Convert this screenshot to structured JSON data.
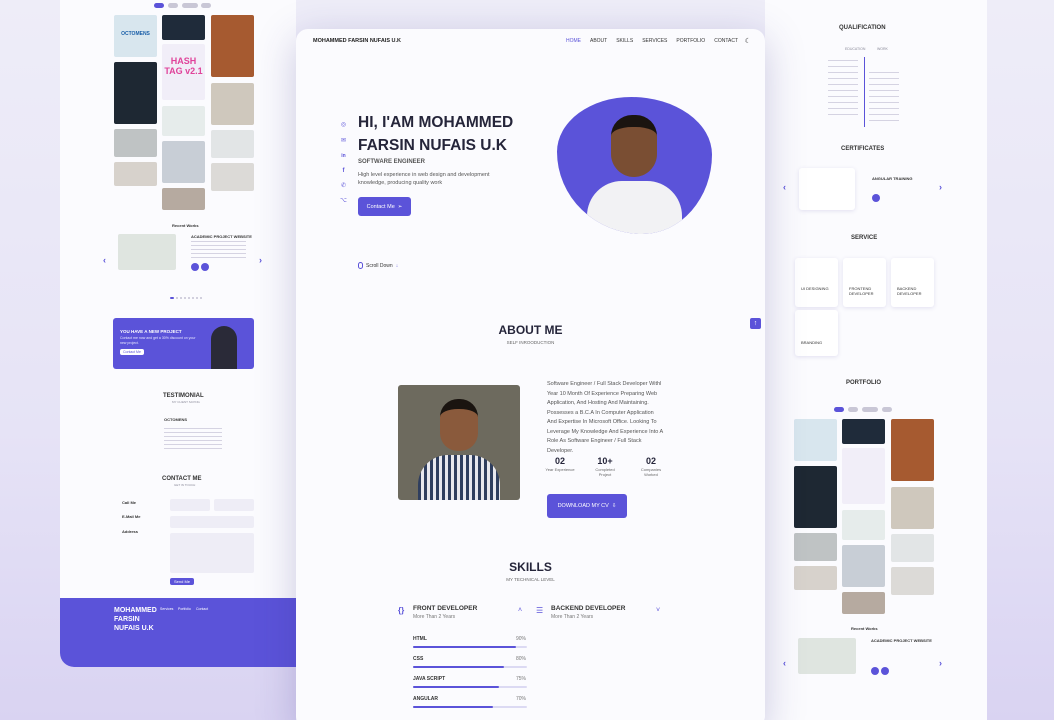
{
  "colors": {
    "accent": "#5b53d9",
    "bg": "#eeedf8"
  },
  "nav": {
    "logo": "MOHAMMED FARSIN NUFAIS U.K",
    "links": [
      "HOME",
      "ABOUT",
      "SKILLS",
      "SERVICES",
      "PORTFOLIO",
      "CONTACT"
    ],
    "theme_icon": "moon-icon"
  },
  "hero": {
    "title": "HI, I'AM MOHAMMED FARSIN NUFAIS U.K",
    "subtitle": "SOFTWARE ENGINEER",
    "description": "High level experience in web design and development knowledge, producing quality work",
    "cta": "Contact Me",
    "scroll": "Scroll Down",
    "socials": [
      "instagram-icon",
      "mail-icon",
      "linkedin-icon",
      "facebook-icon",
      "whatsapp-icon",
      "github-icon"
    ]
  },
  "about": {
    "title": "ABOUT ME",
    "subtitle": "SELF INROODUCTION",
    "text": "Software Engineer / Full Stack Developer Withl Year 10 Month Of Experience Preparing Web Application, And Hosting And Maintaining. Possesses a B.C.A In Computer Application And Expertise In Microsoft Office. Looking To Leverage My Knowledge And Experience Into A Role As Software Engineer / Full Stack Developer.",
    "stats": [
      {
        "num": "02",
        "label": "Year Experience"
      },
      {
        "num": "10+",
        "label": "Completed Project"
      },
      {
        "num": "02",
        "label": "Companies Worked"
      }
    ],
    "download": "DOWNLOAD MY CV"
  },
  "skills": {
    "title": "SKILLS",
    "subtitle": "MY TECHNICAL LEVEL",
    "frontend": {
      "title": "FRONT DEVELOPER",
      "sub": "More Than 2 Years"
    },
    "backend": {
      "title": "BACKEND DEVELOPER",
      "sub": "More Than 2 Years"
    },
    "items": [
      {
        "name": "HTML",
        "pct": "90%",
        "value": 0.9
      },
      {
        "name": "CSS",
        "pct": "80%",
        "value": 0.8
      },
      {
        "name": "JAVA SCRIPT",
        "pct": "75%",
        "value": 0.75
      },
      {
        "name": "ANGULAR",
        "pct": "70%",
        "value": 0.7
      }
    ]
  },
  "left": {
    "recent": "Recent Works",
    "project_title": "ACADEMIC PROJECT WEBSITE",
    "banner_title": "YOU HAVE A NEW PROJECT",
    "banner_text": "Contact me now and get a 30% discount on your new project.",
    "banner_btn": "Contact Me",
    "testimonial": "TESTIMONIAL",
    "testimonial_sub": "MY CLIENT SAYING",
    "client": "OCTOMENS",
    "contact": "CONTACT ME",
    "contact_sub": "GET IN TOUCH",
    "call": "Call Me",
    "email": "E-Mail Me",
    "address": "Address",
    "send": "Send Me",
    "footer_name": "MOHAMMED FARSIN NUFAIS U.K",
    "footer_links": [
      "Services",
      "Portfolio",
      "Contact"
    ],
    "octomens": "OCTOMENS",
    "hashtag": "HASH TAG v2.1"
  },
  "right": {
    "qualification": "QUALIFICATION",
    "education": "EDUCATION",
    "work": "WORK",
    "certificates": "CERTIFICATES",
    "cert_title": "ANGULAR TRAINING",
    "service": "SERVICE",
    "services": [
      "UI DESIGNING",
      "FRONTEND DEVELOPER",
      "BACKEND DEVELOPER",
      "BRANDING"
    ],
    "portfolio": "PORTFOLIO",
    "recent": "Recent Works",
    "project_title": "ACADEMIC PROJECT WEBSITE"
  }
}
